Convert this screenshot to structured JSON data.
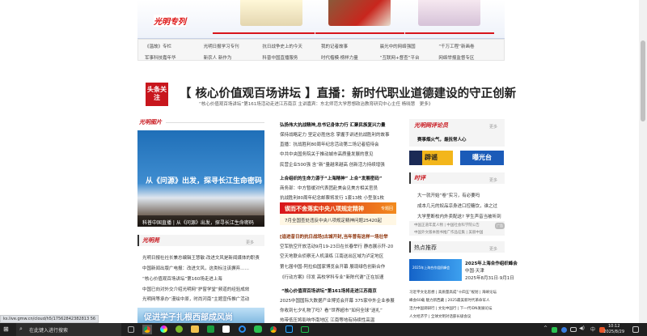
{
  "banner": {
    "logo": "光明专列"
  },
  "quick_links": [
    "《温故》专栏",
    "光明日报学习专刊",
    "抗日战争史上的今天",
    "我的记者故事",
    "晨光中的网络强国",
    "“千万工程”新画卷",
    "军事科技嘉年华",
    "新农人 新作为",
    "科普中国直播服务",
    "时代楷模·榜样力量",
    "“互联网+督查”平台",
    "网络举报监督专区"
  ],
  "headline": {
    "badge": "头条关注",
    "title": "【 核心价值观百场讲坛 】直播：新时代职业道德建设的守正创新",
    "subtitle": "“核心价值观百场讲坛”第161场活动走进江苏南京 主讲嘉宾：东北师范大学思想政治教育研究中心主任 杨晓慧　更多》"
  },
  "left": {
    "logo": "光明图片",
    "image_title": "从《问源》出发，探寻长江生命密码",
    "image_caption": "科普中国直播 | 从《问源》出发，探寻长江生命密码",
    "section": "光明苑",
    "more": "更多",
    "items": [
      "光明日报社社长兼总编辑王慧敏:改进文风是新闻媒体的职责",
      "中国新闻出版广电报：改进文风，这类标注该摒弃……",
      "“核心价值观百场讲坛”第160场走进上海",
      "中国已向对外交介绍光明网“护窗学堂”频道的经验成效",
      "光明网等承办“漫绘中原，时尚河南”主题宣传推广活动"
    ],
    "bottom_banner": "促进学子扎根西部成风尚"
  },
  "middle": {
    "group1": [
      "弘扬伟大抗战精神,总书记身体力行 汇聚民族复兴力量",
      "保持战略定力 坚定必胜信念 掌握手讲述抗战胜利的故事",
      "直播：抗战胜利80周年纪念活动第二场记者招待会",
      "中共中央国务院关于推动城市高质量发展的意见",
      "民营企业500强 含“新”量越来越高 创新活力持续增强"
    ],
    "group2": [
      "上合组织的生命力源于“上海精神” 上合“发展密码”",
      "商务部：中方暂缓对代表团赴美会见美方相关官员",
      "抗战胜利80周年纪念邮票将发行 1套13枚 小型张1枚"
    ],
    "red_banner": "锲而不舍落实中央八项规定精神",
    "red_banner_more": "专题回",
    "yellow_item": "7月全国查处违反中央八项规定精神问题25420起",
    "group3": [
      "[追进昔日的抗日战场]古城开封,当年曾有这样一场壮举",
      "空军航空开放活动9月19-23日在长春举行 静态展示歼-20",
      "空天地联合侦察无人机演练 江南送出区域为泸定地区",
      "第七届中国-阿拉伯国家博览会开幕 展现绿色创新合作",
      "《行动方案》印发 高校学科专业“新陈代谢”正在加速"
    ],
    "group4": [
      "“核心价值观百场讲坛”第161场将走进江苏南京",
      "2025中国国际大数据产业博览会开幕 375家中外企业参展",
      "你收到七夕礼物了吗？看“世界超市”如何全球“送礼”",
      "热带低压将影响华南地区 江南等地有持续性高温"
    ]
  },
  "right": {
    "forum_title": "光明网评论员",
    "forum_more": "更多",
    "forum_item": "赛事烟火气，最抚常人心",
    "btn_rumor": "辟谣",
    "btn_expose": "曝光台",
    "shiping": "时评",
    "shiping_more": "更多",
    "shiping_items": [
      "大一就开始“卷”实习，有必要吗",
      "成本几元的奴品凉身进口控糖饮，谁之过",
      "大学里断校内外卖配送? 学生声音当被听到"
    ],
    "ad_links": [
      "中国正道年度人物",
      "中国社会科学院公告",
      "中国外文版本图书推广作品征集",
      "美丽中国"
    ],
    "ad_label": "广告",
    "hot": "热点推荐",
    "hot_more": "更多",
    "promo_img_text": "2025年上海合作组织峰会",
    "promo_title": "2025年上海合作组织峰会",
    "promo_place": "中国·天津",
    "promo_date": "2025年8月31日·9月1日",
    "hot_links": [
      "习近平文化思想",
      "高质量高成“十四五”规划",
      "海峡论坛",
      "峰会60载 魅力新西藏",
      "2025最美新时代革命军人",
      "活力中国调研行",
      "文化中国行",
      "下一代IDN发展论坛",
      "人文经济学",
      "全球文明对话部长级会议"
    ]
  },
  "status_url": "ks.live.gmw.cn/cloud/h5/17562842382813 56",
  "taskbar": {
    "search_placeholder": "在此键入进行搜索",
    "time": "10:12",
    "date": "2025/8/29",
    "ime": "中"
  }
}
